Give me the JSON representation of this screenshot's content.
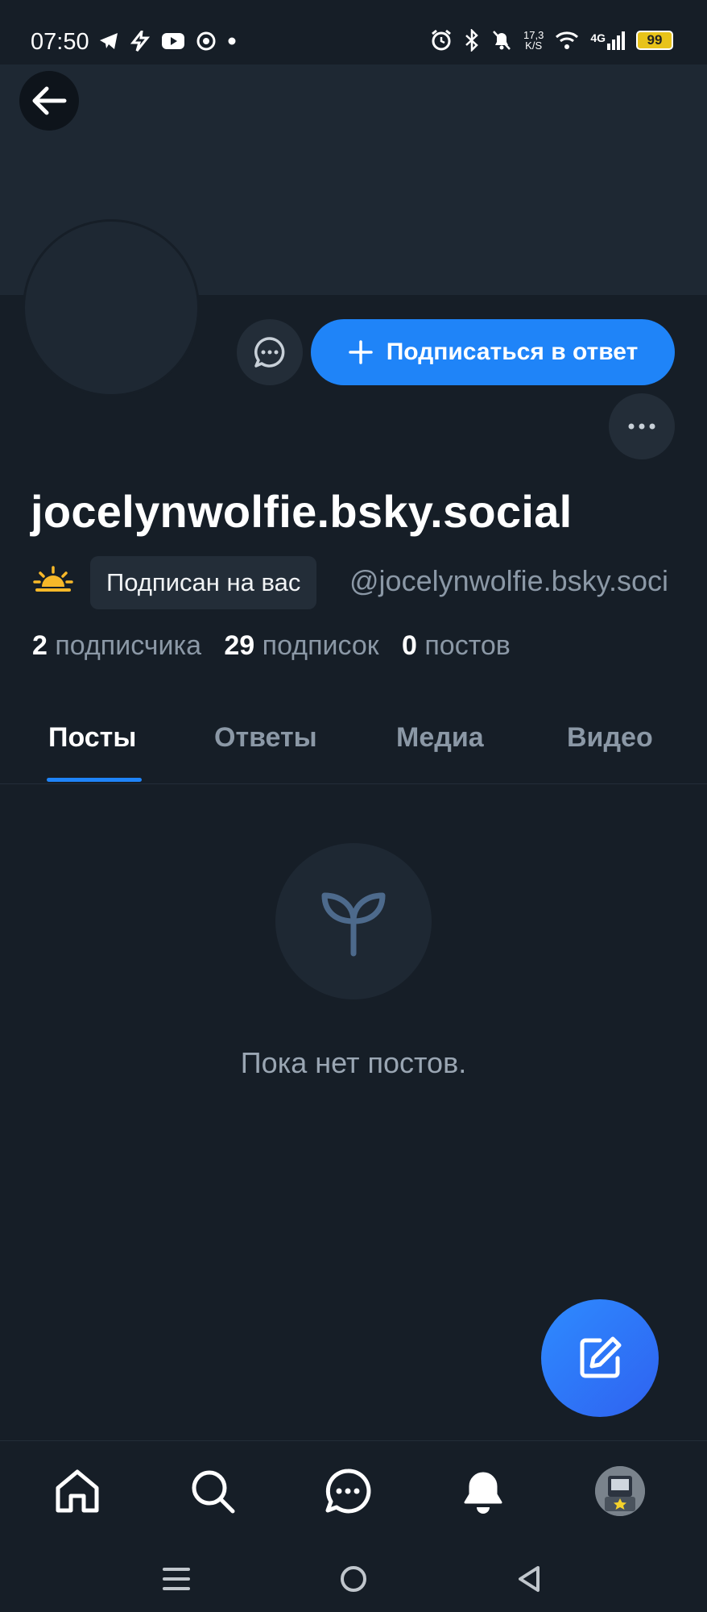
{
  "status_bar": {
    "time": "07:50",
    "speed_top": "17,3",
    "speed_bottom": "K/S",
    "network": "4G",
    "battery": "99",
    "left_icons": [
      "telegram-icon",
      "bolt-app-icon",
      "youtube-icon",
      "chrome-icon",
      "dot-icon"
    ],
    "right_icons": [
      "alarm-icon",
      "bluetooth-icon",
      "mute-bell-icon",
      "wifi-icon",
      "signal-icon"
    ]
  },
  "profile": {
    "display_name": "jocelynwolfie.bsky.social",
    "follows_you_label": "Подписан на вас",
    "handle": "@jocelynwolfie.bsky.soci",
    "followers_count": "2",
    "followers_label": "подписчика",
    "following_count": "29",
    "following_label": "подписок",
    "posts_count": "0",
    "posts_label": "постов"
  },
  "actions": {
    "follow_back_label": "Подписаться в ответ"
  },
  "tabs": [
    {
      "label": "Посты",
      "active": true
    },
    {
      "label": "Ответы",
      "active": false
    },
    {
      "label": "Медиа",
      "active": false
    },
    {
      "label": "Видео",
      "active": false
    }
  ],
  "empty_state": {
    "text": "Пока нет постов.",
    "icon": "sprout-icon"
  },
  "bottom_nav": [
    "home-icon",
    "search-icon",
    "chat-icon",
    "notifications-icon",
    "profile-avatar"
  ],
  "colors": {
    "background": "#161e27",
    "accent": "#1f84f8",
    "muted_text": "#8b98a6"
  }
}
